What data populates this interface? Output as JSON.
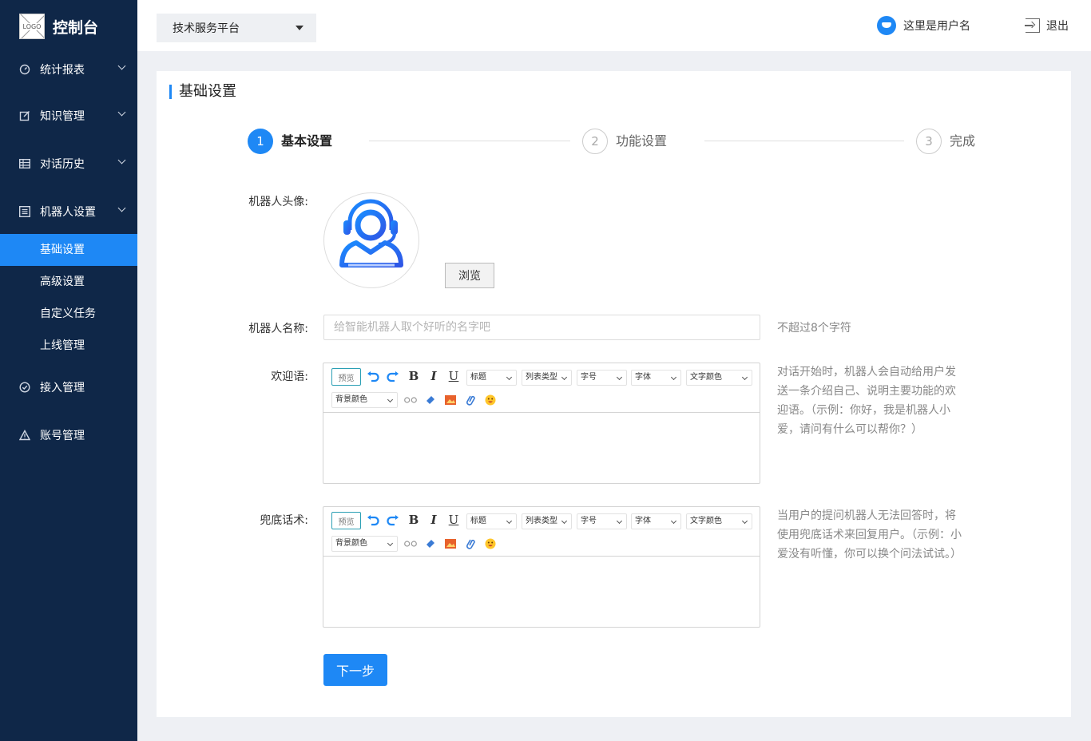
{
  "brand": {
    "logo_text": "LOGO",
    "title": "控制台"
  },
  "sidebar": {
    "menu": [
      {
        "label": "统计报表",
        "icon": "gauge-icon"
      },
      {
        "label": "知识管理",
        "icon": "edit-icon"
      },
      {
        "label": "对话历史",
        "icon": "table-icon"
      },
      {
        "label": "机器人设置",
        "icon": "list-icon"
      },
      {
        "label": "接入管理",
        "icon": "check-circle-icon"
      },
      {
        "label": "账号管理",
        "icon": "warning-icon"
      }
    ],
    "submenu": [
      {
        "label": "基础设置",
        "active": true
      },
      {
        "label": "高级设置",
        "active": false
      },
      {
        "label": "自定义任务",
        "active": false
      },
      {
        "label": "上线管理",
        "active": false
      }
    ]
  },
  "header": {
    "platform": "技术服务平台",
    "username": "这里是用户名",
    "logout": "退出"
  },
  "page": {
    "title": "基础设置"
  },
  "steps": [
    {
      "num": "1",
      "label": "基本设置",
      "state": "active"
    },
    {
      "num": "2",
      "label": "功能设置",
      "state": "todo"
    },
    {
      "num": "3",
      "label": "完成",
      "state": "todo"
    }
  ],
  "form": {
    "avatar_label": "机器人头像:",
    "browse": "浏览",
    "name_label": "机器人名称:",
    "name_placeholder": "给智能机器人取个好听的名字吧",
    "name_value": "",
    "name_hint": "不超过8个字符",
    "welcome_label": "欢迎语:",
    "welcome_hint": "对话开始时，机器人会自动给用户发送一条介绍自己、说明主要功能的欢迎语。（示例：你好，我是机器人小爱，请问有什么可以帮你？）",
    "fallback_label": "兜底话术:",
    "fallback_hint": "当用户的提问机器人无法回答时，将使用兜底话术来回复用户。（示例：小爱没有听懂，你可以换个问法试试。）",
    "next": "下一步"
  },
  "editor_toolbar": {
    "preview": "预览",
    "bold": "B",
    "italic": "I",
    "underline": "U",
    "heading": "标题",
    "list_type": "列表类型",
    "font_size": "字号",
    "font_family": "字体",
    "text_color": "文字颜色",
    "bg_color": "背景颜色"
  },
  "colors": {
    "sidebar": "#0f2748",
    "accent": "#1e88f5",
    "background": "#eef0f4"
  }
}
